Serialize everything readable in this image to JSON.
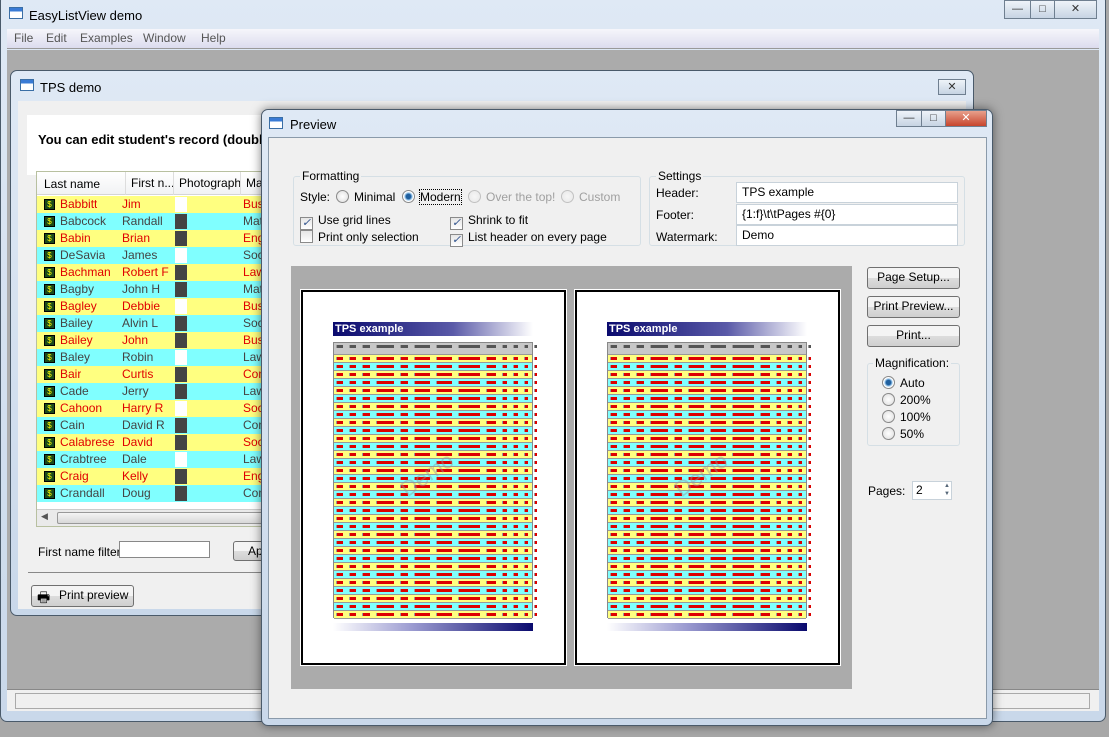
{
  "app": {
    "title": "EasyListView demo",
    "menu": [
      "File",
      "Edit",
      "Examples",
      "Window",
      "Help"
    ],
    "controls": {
      "minimize": "—",
      "maximize": "□",
      "close": "✕"
    }
  },
  "tps": {
    "title": "TPS demo",
    "instruction": "You can edit student's record (double c",
    "columns": [
      "Last name",
      "First n...",
      "Photograph",
      "Maj"
    ],
    "rows": [
      [
        "Babbitt",
        "Jim",
        "Busi"
      ],
      [
        "Babcock",
        "Randall",
        "Math"
      ],
      [
        "Babin",
        "Brian",
        "Eng"
      ],
      [
        "DeSavia",
        "James",
        "Soc"
      ],
      [
        "Bachman",
        "Robert F",
        "Law"
      ],
      [
        "Bagby",
        "John H",
        "Math"
      ],
      [
        "Bagley",
        "Debbie",
        "Busi"
      ],
      [
        "Bailey",
        "Alvin L",
        "Soc"
      ],
      [
        "Bailey",
        "John",
        "Busi"
      ],
      [
        "Baley",
        "Robin",
        "Law"
      ],
      [
        "Bair",
        "Curtis",
        "Com"
      ],
      [
        "Cade",
        "Jerry",
        "Law"
      ],
      [
        "Cahoon",
        "Harry R",
        "Soc"
      ],
      [
        "Cain",
        "David R",
        "Com"
      ],
      [
        "Calabrese",
        "David",
        "Soc"
      ],
      [
        "Crabtree",
        "Dale",
        "Law"
      ],
      [
        "Craig",
        "Kelly",
        "Eng"
      ],
      [
        "Crandall",
        "Doug",
        "Com"
      ]
    ],
    "filter_label": "First name filter:",
    "filter_value": "",
    "apply": "Apply",
    "print_preview": "Print preview",
    "colors": {
      "yellow": "#ffff80",
      "cyan": "#80ffff",
      "red": "#e00000"
    }
  },
  "preview": {
    "title": "Preview",
    "formatting": {
      "label": "Formatting",
      "style_label": "Style:",
      "styles": [
        "Minimal",
        "Modern",
        "Over the top!",
        "Custom"
      ],
      "selected_style": "Modern",
      "use_grid_lines": {
        "label": "Use grid lines",
        "checked": true
      },
      "print_only_selection": {
        "label": "Print only selection",
        "checked": false
      },
      "shrink_to_fit": {
        "label": "Shrink to fit",
        "checked": true
      },
      "list_header": {
        "label": "List header on every page",
        "checked": true
      }
    },
    "settings": {
      "label": "Settings",
      "header_label": "Header:",
      "header": "TPS example",
      "footer_label": "Footer:",
      "footer": "{1:f}\\t\\tPages #{0}",
      "watermark_label": "Watermark:",
      "watermark": "Demo"
    },
    "buttons": {
      "page_setup": "Page Setup...",
      "print_preview": "Print Preview...",
      "print": "Print..."
    },
    "magnification": {
      "label": "Magnification:",
      "options": [
        "Auto",
        "200%",
        "100%",
        "50%"
      ],
      "selected": "Auto"
    },
    "pages_label": "Pages:",
    "pages": "2",
    "page_title": "TPS example",
    "watermark_text": "Demo"
  }
}
